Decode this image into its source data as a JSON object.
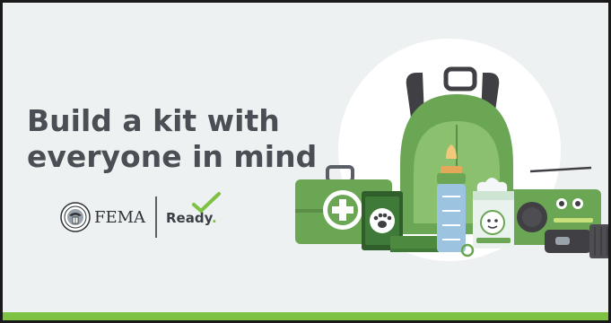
{
  "banner": {
    "headline_line1": "Build a kit with",
    "headline_line2": "everyone in mind"
  },
  "logos": {
    "fema_label": "FEMA",
    "ready_label": "Ready",
    "ready_suffix": "."
  },
  "colors": {
    "background": "#eef1f2",
    "headline": "#4a4f55",
    "accent_green": "#7dc242",
    "kit_green": "#6ba654"
  },
  "icons": [
    "fema-seal-icon",
    "ready-check-icon",
    "backpack-icon",
    "first-aid-kit-icon",
    "pet-food-can-icon",
    "baby-bottle-icon",
    "baby-formula-icon",
    "radio-icon",
    "flashlight-icon"
  ]
}
